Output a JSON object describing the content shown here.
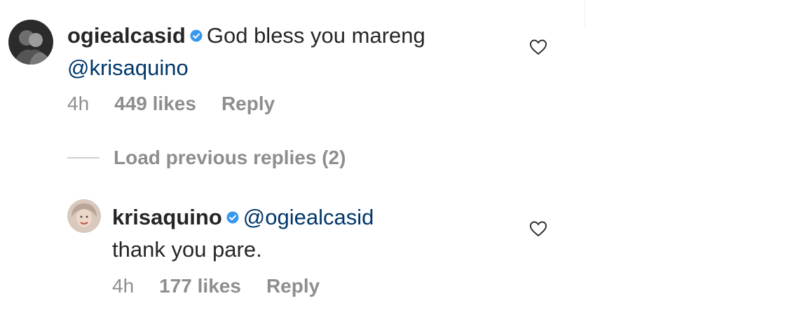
{
  "comments": [
    {
      "username": "ogiealcasid",
      "verified": true,
      "text_line1": "God bless you mareng",
      "mention": "@krisaquino",
      "text_line2": "",
      "time": "4h",
      "likes": "449 likes",
      "reply_label": "Reply",
      "icon": "heart-outline-icon"
    },
    {
      "username": "krisaquino",
      "verified": true,
      "mention": "@ogiealcasid",
      "text_line2": "thank you pare.",
      "time": "4h",
      "likes": "177 likes",
      "reply_label": "Reply",
      "icon": "heart-outline-icon"
    }
  ],
  "load_previous": "Load previous replies (2)",
  "colors": {
    "text": "#262626",
    "muted": "#8e8e8e",
    "mention": "#00376b",
    "verified": "#3897f0"
  }
}
